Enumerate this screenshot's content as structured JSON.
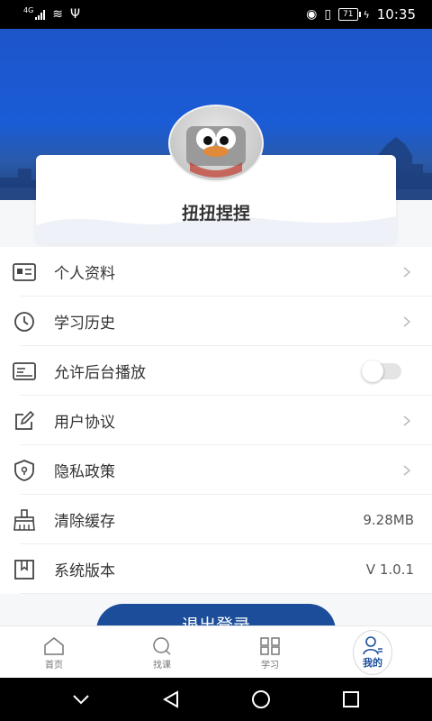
{
  "status_bar": {
    "network": "4G",
    "time": "10:35",
    "battery": "71"
  },
  "profile": {
    "username": "扭扭捏捏"
  },
  "menu": {
    "items": [
      {
        "label": "个人资料",
        "icon": "id-card-icon"
      },
      {
        "label": "学习历史",
        "icon": "clock-icon"
      },
      {
        "label": "允许后台播放",
        "icon": "keyboard-icon",
        "toggle": false
      },
      {
        "label": "用户协议",
        "icon": "edit-icon"
      },
      {
        "label": "隐私政策",
        "icon": "shield-icon"
      },
      {
        "label": "清除缓存",
        "icon": "broom-icon",
        "value": "9.28MB"
      },
      {
        "label": "系统版本",
        "icon": "bookmark-icon",
        "value": "V 1.0.1"
      }
    ]
  },
  "logout": {
    "label": "退出登录"
  },
  "tabbar": {
    "tabs": [
      {
        "label": "首页",
        "icon": "home-icon"
      },
      {
        "label": "找课",
        "icon": "search-icon"
      },
      {
        "label": "学习",
        "icon": "grid-icon"
      },
      {
        "label": "我的",
        "icon": "user-icon",
        "active": true
      }
    ]
  },
  "colors": {
    "primary": "#1b4d9b",
    "banner": "#1a5cd6"
  }
}
